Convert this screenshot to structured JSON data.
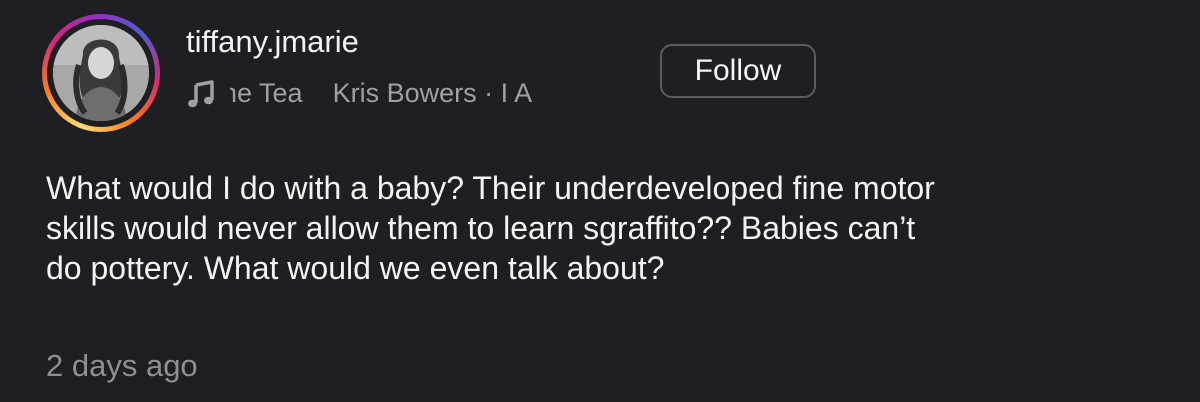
{
  "post": {
    "username": "tiffany.jmarie",
    "music": {
      "icon": "music-note-icon",
      "ticker_text": "he Tea    Kris Bowers · I A"
    },
    "follow_label": "Follow",
    "caption": "What would I do with a baby? Their underdeveloped fine motor\nskills would never allow them to learn sgraffito?? Babies can’t\ndo pottery. What would we even talk about?",
    "timestamp": "2 days ago"
  },
  "colors": {
    "background": "#1f1f23",
    "text": "#f3f3f3",
    "muted": "#8e8e93",
    "button_border": "#5b5b60"
  }
}
